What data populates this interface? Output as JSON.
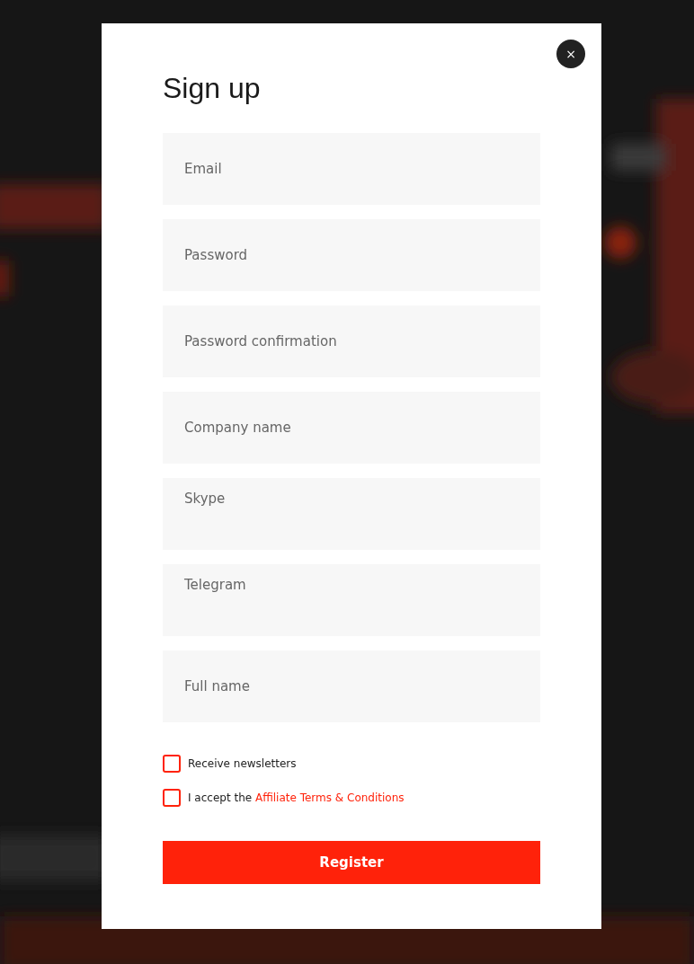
{
  "dialog": {
    "title": "Sign up",
    "close": "×"
  },
  "fields": [
    {
      "placeholder": "Email",
      "kind": "input"
    },
    {
      "placeholder": "Password",
      "kind": "input"
    },
    {
      "placeholder": "Password confirmation",
      "kind": "input"
    },
    {
      "placeholder": "Company name",
      "kind": "input"
    },
    {
      "placeholder": "Skype",
      "kind": "textarea"
    },
    {
      "placeholder": "Telegram",
      "kind": "textarea"
    },
    {
      "placeholder": "Full name",
      "kind": "input"
    }
  ],
  "checkboxes": [
    {
      "label": "Receive newsletters",
      "checked": false
    },
    {
      "label": "I accept the ",
      "link": "Affiliate Terms & Conditions",
      "checked": false
    }
  ],
  "submit": "Register"
}
